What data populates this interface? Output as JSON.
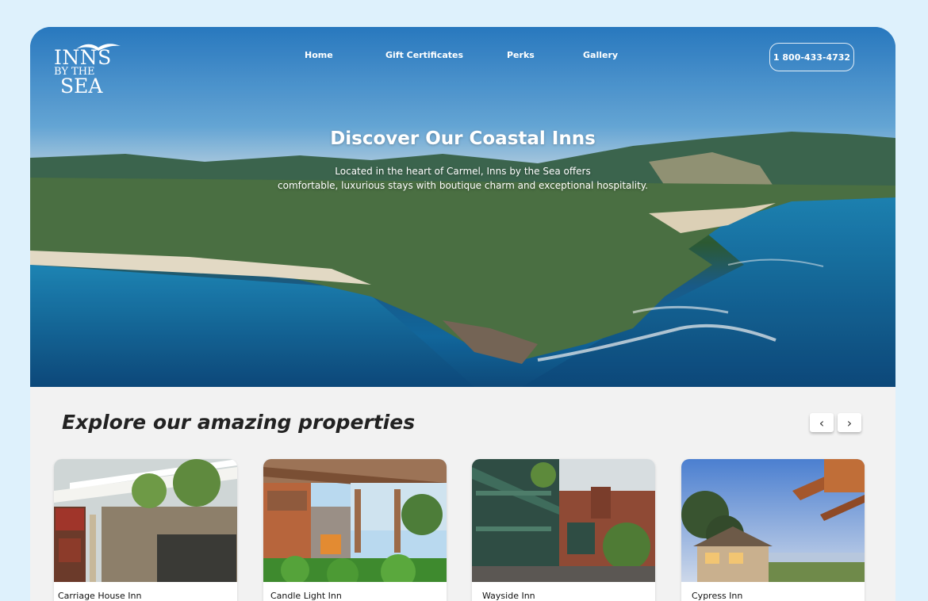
{
  "brand": {
    "logo_line1": "INNS",
    "logo_line2": "BY THE",
    "logo_line3": "SEA",
    "logo_icon": "seagull-icon"
  },
  "nav": {
    "items": [
      {
        "label": "Home"
      },
      {
        "label": "Gift Certificates"
      },
      {
        "label": "Perks"
      },
      {
        "label": "Gallery"
      }
    ],
    "phone": "1 800-433-4732"
  },
  "hero": {
    "title": "Discover Our Coastal Inns",
    "subtitle_line1": "Located in the heart of Carmel, Inns by the Sea offers",
    "subtitle_line2": "comfortable, luxurious stays with boutique charm and exceptional hospitality."
  },
  "properties": {
    "heading": "Explore our amazing properties",
    "prev_icon": "chevron-left-icon",
    "next_icon": "chevron-right-icon",
    "prev_glyph": "‹",
    "next_glyph": "›",
    "cards": [
      {
        "name": "Carriage House Inn"
      },
      {
        "name": "Candle Light Inn"
      },
      {
        "name": "Wayside Inn"
      },
      {
        "name": "Cypress Inn"
      }
    ]
  },
  "colors": {
    "page_background": "#def1fc",
    "section_background": "#f2f2f2",
    "hero_sky": "#2f86cc",
    "ocean": "#126ca4"
  }
}
